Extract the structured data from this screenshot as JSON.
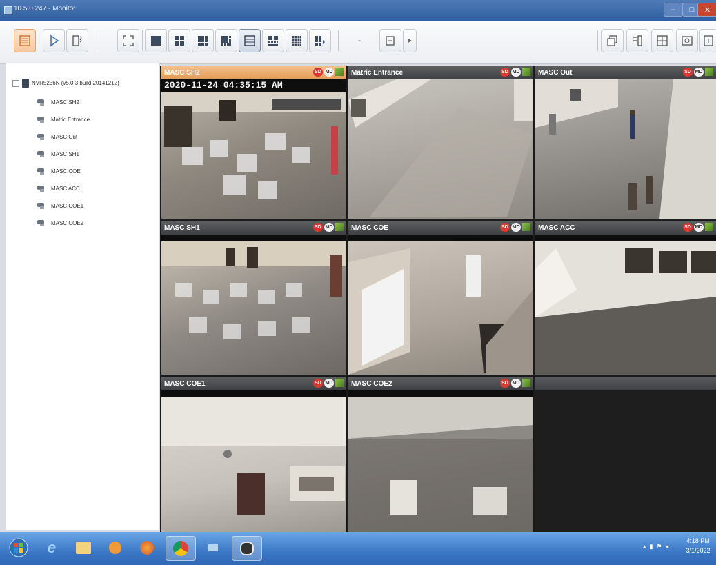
{
  "window": {
    "title": "10.5.0.247 - Monitor"
  },
  "toolbar": {
    "buttons": [
      "monitor",
      "playback",
      "settings",
      "fullscreen",
      "layout-1",
      "layout-4",
      "layout-6",
      "layout-8",
      "layout-9",
      "layout-10",
      "layout-13",
      "layout-16",
      "layout-dropdown",
      "sequence",
      "sequence-next",
      "window-1",
      "window-2",
      "window-3",
      "window-4",
      "window-5"
    ],
    "dropdown_label": "-"
  },
  "tree": {
    "root_label": "NVR5256N (v5.0.3 build 20141212)",
    "cameras": [
      "MASC SH2",
      "Matric Entrance",
      "MASC Out",
      "MASC SH1",
      "MASC COE",
      "MASC ACC",
      "MASC COE1",
      "MASC COE2"
    ]
  },
  "cells": [
    {
      "title": "MASC SH2",
      "timestamp": "2020-11-24 04:35:15 AM",
      "selected": true
    },
    {
      "title": "Matric Entrance",
      "timestamp": "",
      "selected": false
    },
    {
      "title": "MASC Out",
      "timestamp": "",
      "selected": false
    },
    {
      "title": "MASC SH1",
      "timestamp": "",
      "selected": false
    },
    {
      "title": "MASC COE",
      "timestamp": "",
      "selected": false
    },
    {
      "title": "MASC ACC",
      "timestamp": "",
      "selected": false
    },
    {
      "title": "MASC COE1",
      "timestamp": "",
      "selected": false
    },
    {
      "title": "MASC COE2",
      "timestamp": "",
      "selected": false
    },
    {
      "title": "",
      "timestamp": "",
      "selected": false
    }
  ],
  "badges": {
    "record": "SD",
    "motion": "MD"
  },
  "taskbar": {
    "time": "4:18 PM",
    "date": "3/1/2022"
  },
  "colors": {
    "selected_header": "#e39a55",
    "header": "#3e3f42",
    "taskbar": "#3c78c6"
  }
}
